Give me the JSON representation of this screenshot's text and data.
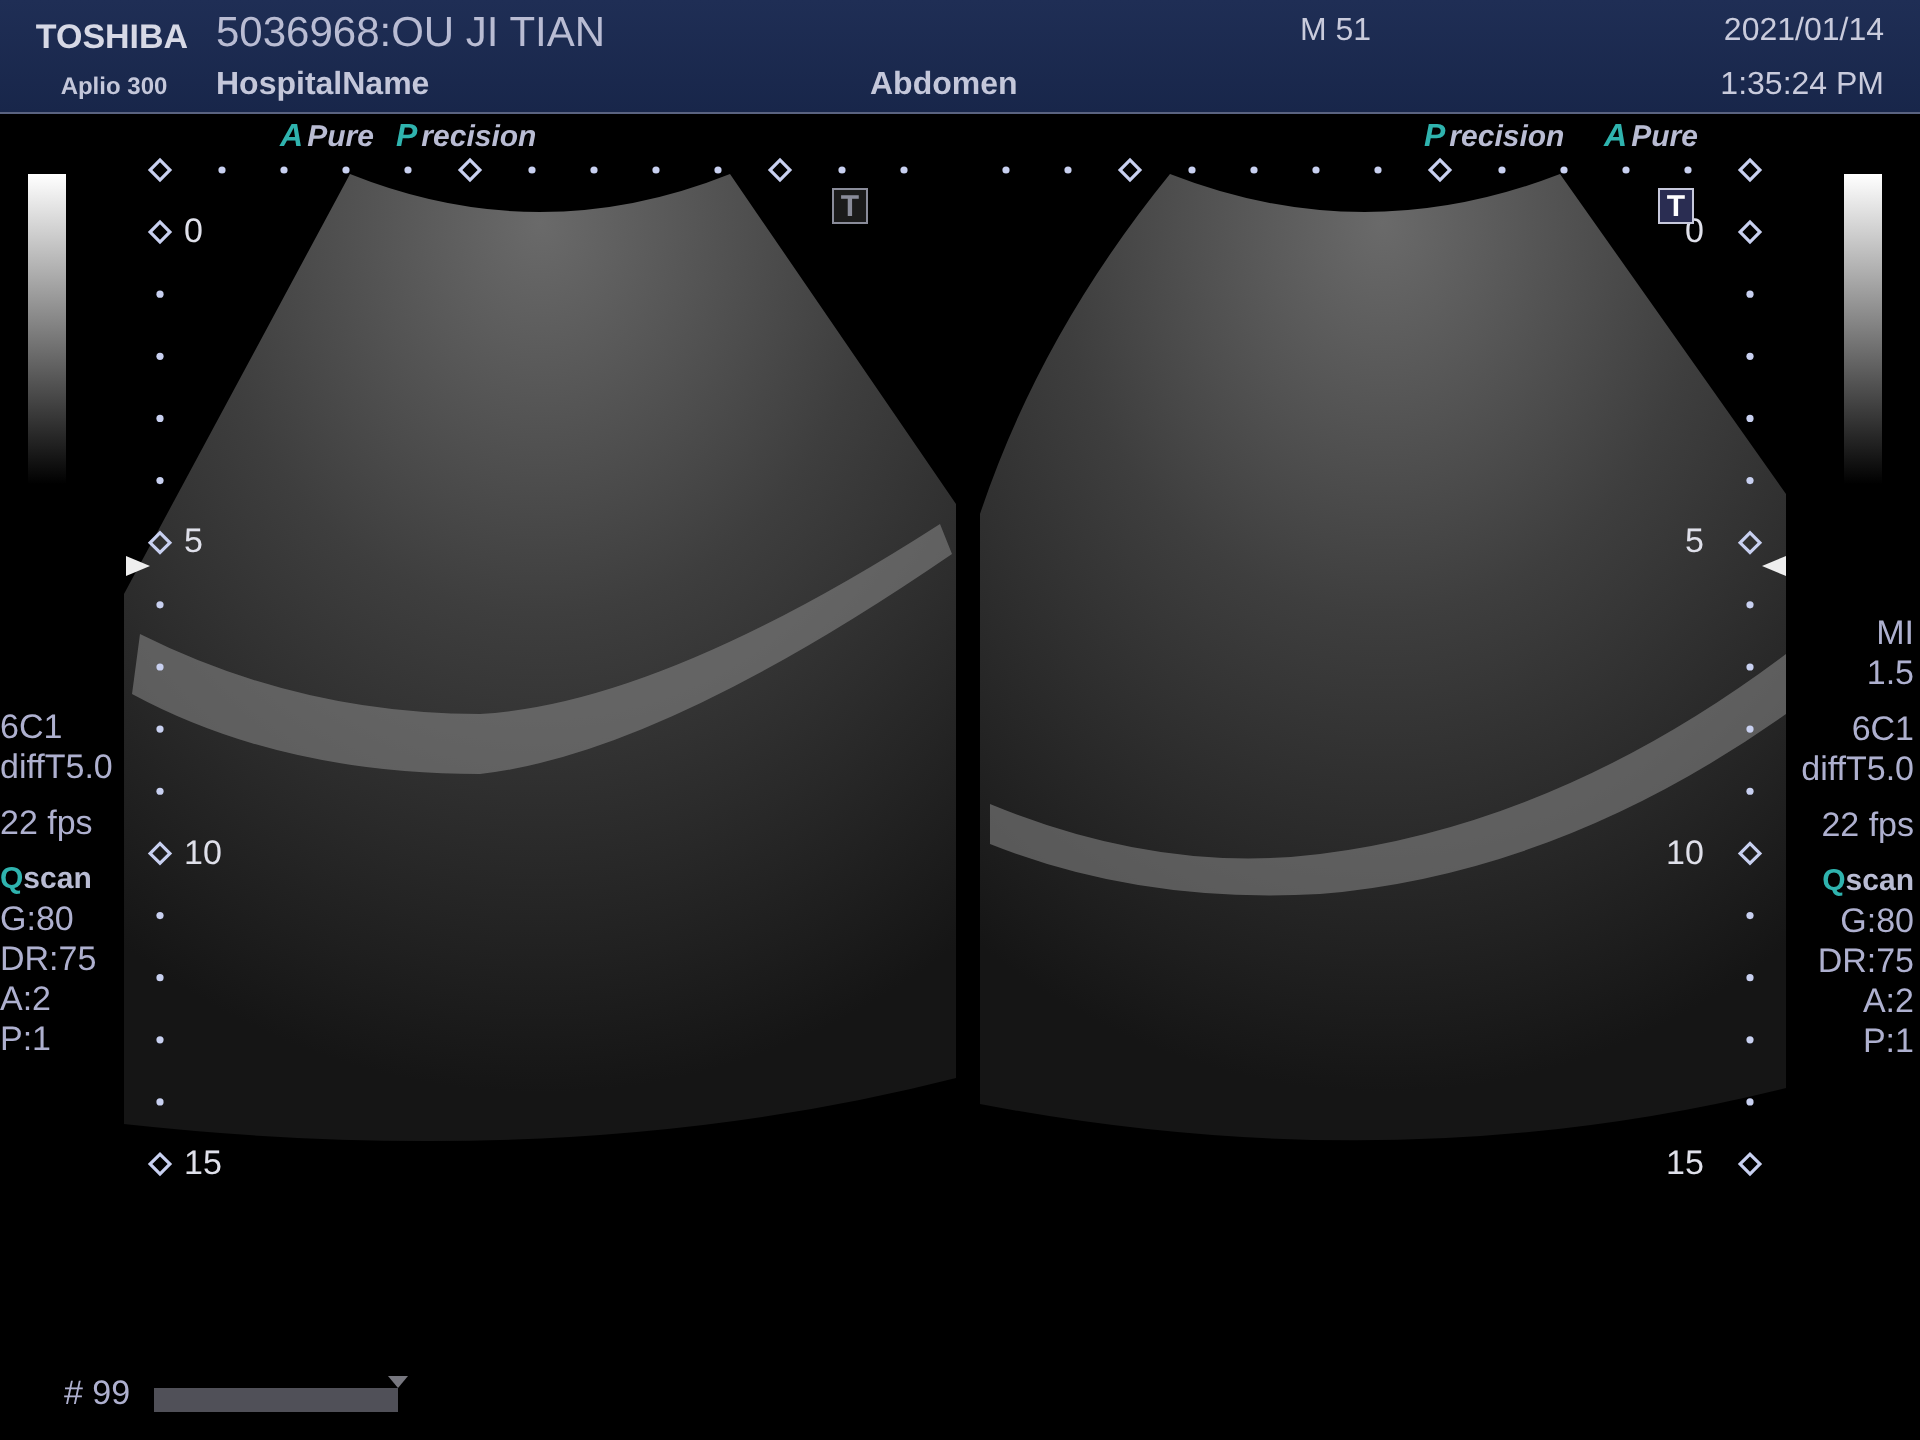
{
  "header": {
    "brand": "TOSHIBA",
    "model": "Aplio 300",
    "patient": "5036968:OU JI TIAN",
    "hospital": "HospitalName",
    "mode": "M 51",
    "preset": "Abdomen",
    "date": "2021/01/14",
    "time": "1:35:24 PM"
  },
  "images": [
    {
      "tags": [
        {
          "initial": "A",
          "rest": "Pure"
        },
        {
          "initial": "P",
          "rest": "recision"
        }
      ],
      "marker": {
        "text": "T",
        "active": false
      },
      "depths": [
        "0",
        "5",
        "10",
        "15"
      ],
      "params": [
        [
          {
            "kind": "plain",
            "text": "6C1"
          },
          {
            "kind": "plain",
            "text": "diffT5.0"
          }
        ],
        [
          {
            "kind": "plain",
            "text": "22 fps"
          }
        ],
        [
          {
            "kind": "accent",
            "initial": "Q",
            "text": "scan"
          },
          {
            "kind": "plain",
            "text": "G:80"
          },
          {
            "kind": "plain",
            "text": "DR:75"
          },
          {
            "kind": "plain",
            "text": "A:2"
          },
          {
            "kind": "plain",
            "text": "P:1"
          }
        ]
      ]
    },
    {
      "tags": [
        {
          "initial": "P",
          "rest": "recision"
        },
        {
          "initial": "A",
          "rest": "Pure"
        }
      ],
      "marker": {
        "text": "T",
        "active": true
      },
      "depths": [
        "0",
        "5",
        "10",
        "15"
      ],
      "params": [
        [
          {
            "kind": "plain",
            "text": "MI"
          },
          {
            "kind": "plain",
            "text": "1.5"
          }
        ],
        [
          {
            "kind": "plain",
            "text": "6C1"
          },
          {
            "kind": "plain",
            "text": "diffT5.0"
          }
        ],
        [
          {
            "kind": "plain",
            "text": "22 fps"
          }
        ],
        [
          {
            "kind": "accent",
            "initial": "Q",
            "text": "scan"
          },
          {
            "kind": "plain",
            "text": "G:80"
          },
          {
            "kind": "plain",
            "text": "DR:75"
          },
          {
            "kind": "plain",
            "text": "A:2"
          },
          {
            "kind": "plain",
            "text": "P:1"
          }
        ]
      ]
    }
  ],
  "cine": {
    "frame": "# 99",
    "level": 1
  }
}
